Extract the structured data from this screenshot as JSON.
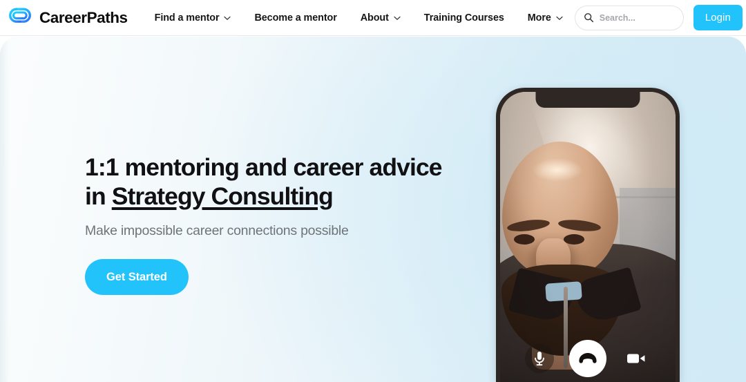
{
  "brand": {
    "name": "CareerPaths",
    "logo_icon": "careerpaths-cp-monogram-icon",
    "logo_color_start": "#18d2ff",
    "logo_color_end": "#2b7bff"
  },
  "nav": {
    "items": [
      {
        "label": "Find a mentor",
        "has_dropdown": true,
        "dropdown_icon": "chevron-down-icon"
      },
      {
        "label": "Become a mentor",
        "has_dropdown": false
      },
      {
        "label": "About",
        "has_dropdown": true,
        "dropdown_icon": "chevron-down-icon"
      },
      {
        "label": "Training Courses",
        "has_dropdown": false
      },
      {
        "label": "More",
        "has_dropdown": true,
        "dropdown_icon": "chevron-down-icon"
      }
    ]
  },
  "search": {
    "icon": "search-icon",
    "placeholder": "Search...",
    "value": ""
  },
  "auth": {
    "login_label": "Login",
    "login_color": "#22c3fb"
  },
  "hero": {
    "headline_line1": "1:1 mentoring and career advice",
    "headline_line2_prefix": "in ",
    "headline_line2_underlined": "Strategy Consulting",
    "subheadline": "Make impossible career connections possible",
    "cta_label": "Get Started",
    "cta_color": "#22c3fb",
    "background_start": "#fbfdfd",
    "background_end": "#d2eaf6"
  },
  "phone": {
    "device": "smartphone-mockup",
    "bezel_color": "#2e2723",
    "screen_content": "video-call-with-bearded-man",
    "call_controls": [
      {
        "name": "microphone-button",
        "icon": "microphone-icon",
        "style": "dark-translucent"
      },
      {
        "name": "end-call-button",
        "icon": "phone-hangup-icon",
        "style": "white"
      },
      {
        "name": "video-toggle-button",
        "icon": "video-camera-icon",
        "style": "transparent"
      }
    ]
  }
}
